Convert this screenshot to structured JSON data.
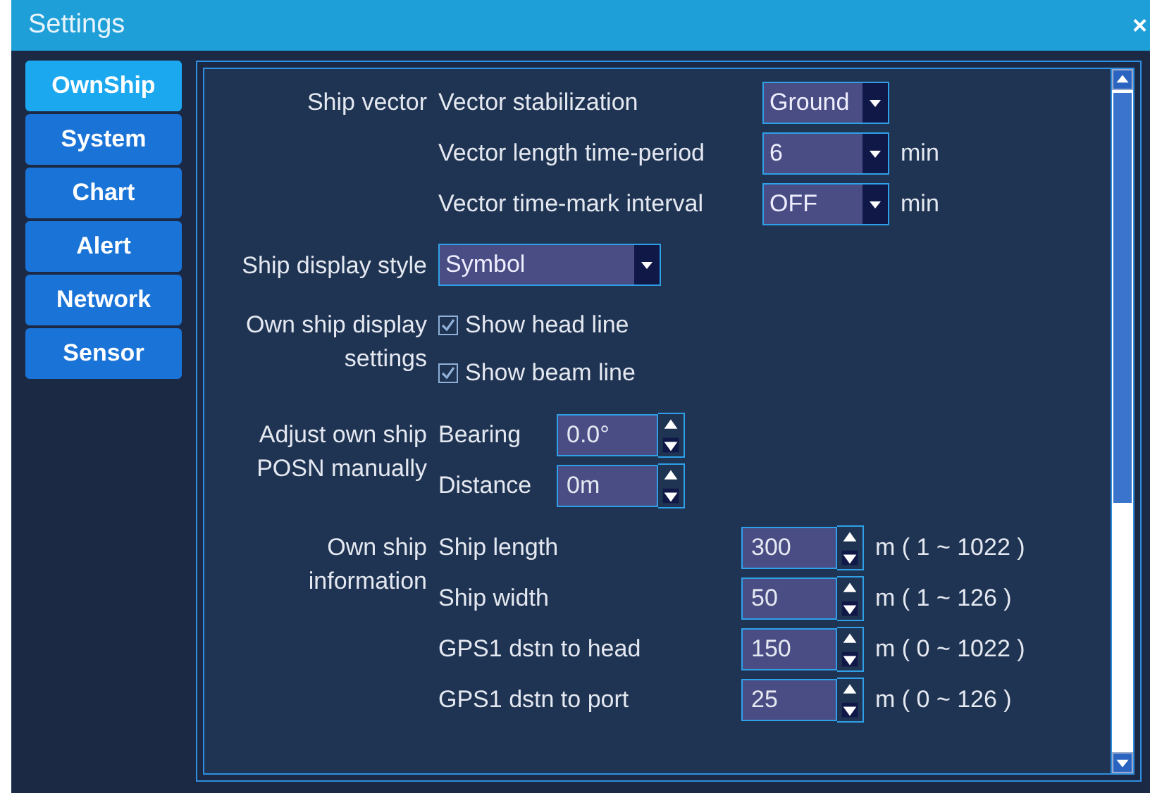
{
  "window": {
    "title": "Settings",
    "close": "×"
  },
  "sidebar": {
    "items": [
      {
        "label": "OwnShip",
        "selected": true
      },
      {
        "label": "System",
        "selected": false
      },
      {
        "label": "Chart",
        "selected": false
      },
      {
        "label": "Alert",
        "selected": false
      },
      {
        "label": "Network",
        "selected": false
      },
      {
        "label": "Sensor",
        "selected": false
      }
    ]
  },
  "sections": [
    {
      "label": "Ship vector",
      "rows": [
        {
          "kind": "dropdown",
          "label": "Vector stabilization",
          "value": "Ground"
        },
        {
          "kind": "dropdown",
          "label": "Vector length time-period",
          "value": "6",
          "unit": "min"
        },
        {
          "kind": "dropdown",
          "label": "Vector time-mark interval",
          "value": "OFF",
          "unit": "min"
        }
      ]
    },
    {
      "label": "Ship display style",
      "rows": [
        {
          "kind": "dropdown",
          "value": "Symbol"
        }
      ]
    },
    {
      "label": "Own ship display settings",
      "rows": [
        {
          "kind": "checkbox",
          "label": "Show head line",
          "checked": true
        },
        {
          "kind": "checkbox",
          "label": "Show beam line",
          "checked": true
        }
      ]
    },
    {
      "label": "Adjust own ship POSN manually",
      "rows": [
        {
          "kind": "spinner",
          "label": "Bearing",
          "value": "0.0°"
        },
        {
          "kind": "spinner",
          "label": "Distance",
          "value": "0m"
        }
      ]
    },
    {
      "label": "Own ship information",
      "rows": [
        {
          "kind": "spinner",
          "label": "Ship length",
          "value": "300",
          "unit": "m ( 1 ~ 1022 )"
        },
        {
          "kind": "spinner",
          "label": "Ship width",
          "value": "50",
          "unit": "m ( 1 ~ 126 )"
        },
        {
          "kind": "spinner",
          "label": "GPS1 dstn to head",
          "value": "150",
          "unit": "m ( 0 ~ 1022 )"
        },
        {
          "kind": "spinner",
          "label": "GPS1 dstn to port",
          "value": "25",
          "unit": "m ( 0 ~ 126 )"
        }
      ]
    }
  ]
}
